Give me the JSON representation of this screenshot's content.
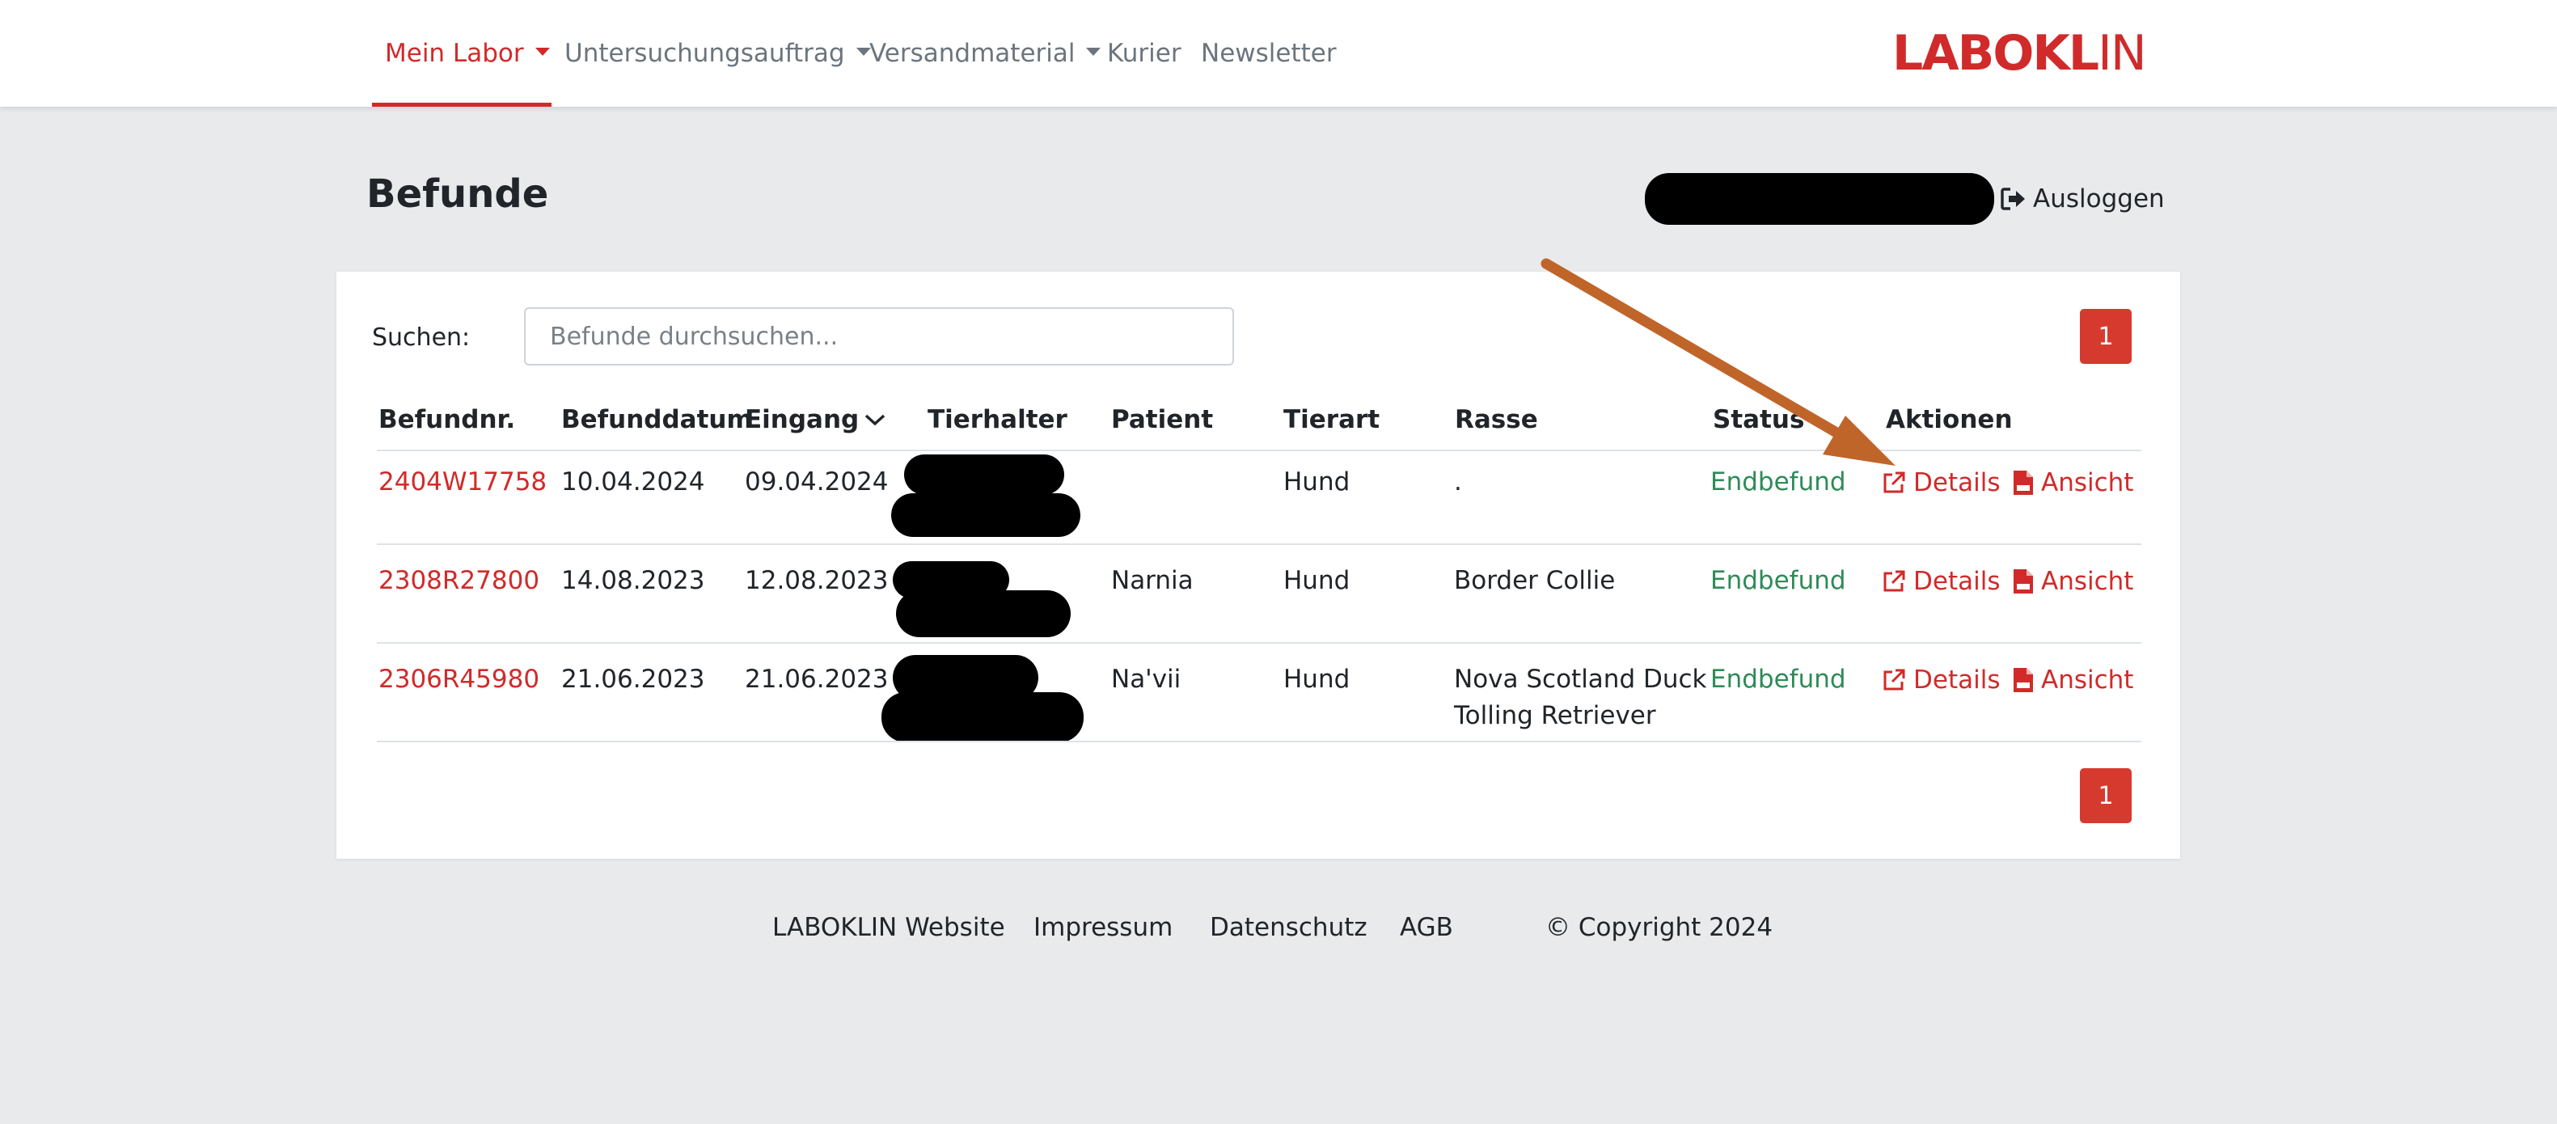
{
  "nav": {
    "items": [
      {
        "label": "Mein Labor",
        "dropdown": true,
        "active": true
      },
      {
        "label": "Untersuchungsauftrag",
        "dropdown": true,
        "active": false
      },
      {
        "label": "Versandmaterial",
        "dropdown": true,
        "active": false
      },
      {
        "label": "Kurier",
        "dropdown": false,
        "active": false
      },
      {
        "label": "Newsletter",
        "dropdown": false,
        "active": false
      }
    ],
    "logo_bold": "LABOKL",
    "logo_thin": "IN"
  },
  "header": {
    "title": "Befunde",
    "logout_label": "Ausloggen"
  },
  "search": {
    "label": "Suchen:",
    "placeholder": "Befunde durchsuchen..."
  },
  "pagination": {
    "current_page": "1"
  },
  "table": {
    "columns": [
      "Befundnr.",
      "Befunddatum",
      "Eingang",
      "Tierhalter",
      "Patient",
      "Tierart",
      "Rasse",
      "Status",
      "Aktionen"
    ],
    "sorted_column": "Eingang",
    "rows": [
      {
        "befundnr": "2404W17758",
        "befunddatum": "10.04.2024",
        "eingang": "09.04.2024",
        "patient": "",
        "tierart": "Hund",
        "rasse_line1": ".",
        "rasse_line2": "",
        "status": "Endbefund"
      },
      {
        "befundnr": "2308R27800",
        "befunddatum": "14.08.2023",
        "eingang": "12.08.2023",
        "patient": "Narnia",
        "tierart": "Hund",
        "rasse_line1": "Border Collie",
        "rasse_line2": "",
        "status": "Endbefund"
      },
      {
        "befundnr": "2306R45980",
        "befunddatum": "21.06.2023",
        "eingang": "21.06.2023",
        "patient": "Na'vii",
        "tierart": "Hund",
        "rasse_line1": "Nova Scotland Duck",
        "rasse_line2": "Tolling Retriever",
        "status": "Endbefund"
      }
    ],
    "action_details": "Details",
    "action_view": "Ansicht"
  },
  "footer": {
    "links": [
      "LABOKLIN Website",
      "Impressum",
      "Datenschutz",
      "AGB"
    ],
    "copyright": "© Copyright 2024"
  },
  "colors": {
    "accent": "#d12a2a",
    "status_ok": "#2e8b57",
    "annotation_arrow": "#c0652a",
    "background": "#e9eaec"
  },
  "icons": {
    "logout": "sign-out-icon",
    "details": "external-link-icon",
    "view": "file-pdf-icon",
    "sort": "chevron-down-icon"
  }
}
